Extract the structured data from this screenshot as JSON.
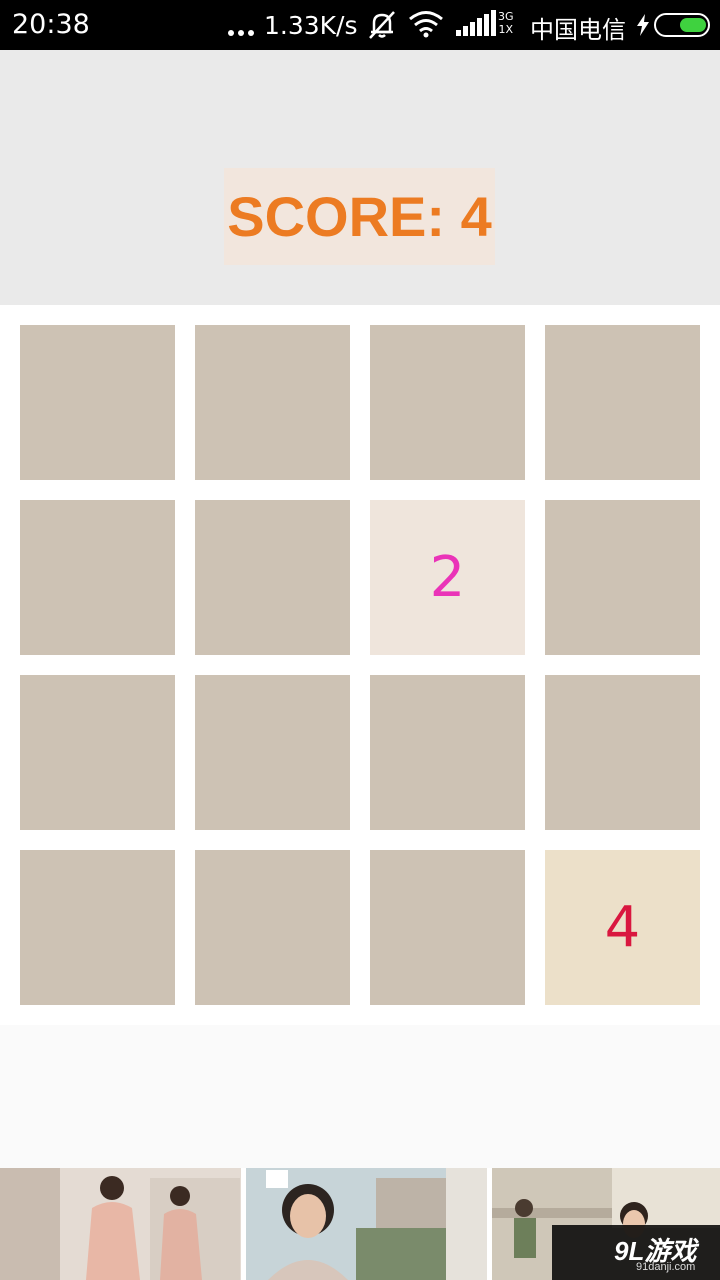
{
  "status_bar": {
    "time": "20:38",
    "net_speed": "1.33K/s",
    "network_gen_top": "3G",
    "network_gen_bottom": "1X",
    "carrier": "中国电信",
    "icons": [
      "more-dots-icon",
      "mute-bell-icon",
      "wifi-icon",
      "signal-icon",
      "charging-bolt-icon",
      "battery-icon"
    ],
    "battery_level": 0.55
  },
  "game": {
    "score_text": "SCORE: 4",
    "grid": [
      [
        "",
        "",
        "",
        ""
      ],
      [
        "",
        "",
        "2",
        ""
      ],
      [
        "",
        "",
        "",
        ""
      ],
      [
        "",
        "",
        "",
        "4"
      ]
    ],
    "colors": {
      "empty_tile": "#cdc2b4",
      "tile_2_bg": "#efe5dc",
      "tile_2_text": "#ea33b8",
      "tile_4_bg": "#ece0c9",
      "tile_4_text": "#d9173f",
      "score_text": "#ec7b22",
      "score_bg": "#f2e6dd"
    }
  },
  "ad_banner": {
    "images": [
      "woman-in-pink-dress-photo",
      "woman-with-glasses-photo",
      "woman-on-bridge-photo"
    ],
    "watermark_logo": "9L游戏",
    "watermark_url": "91danji.com"
  }
}
